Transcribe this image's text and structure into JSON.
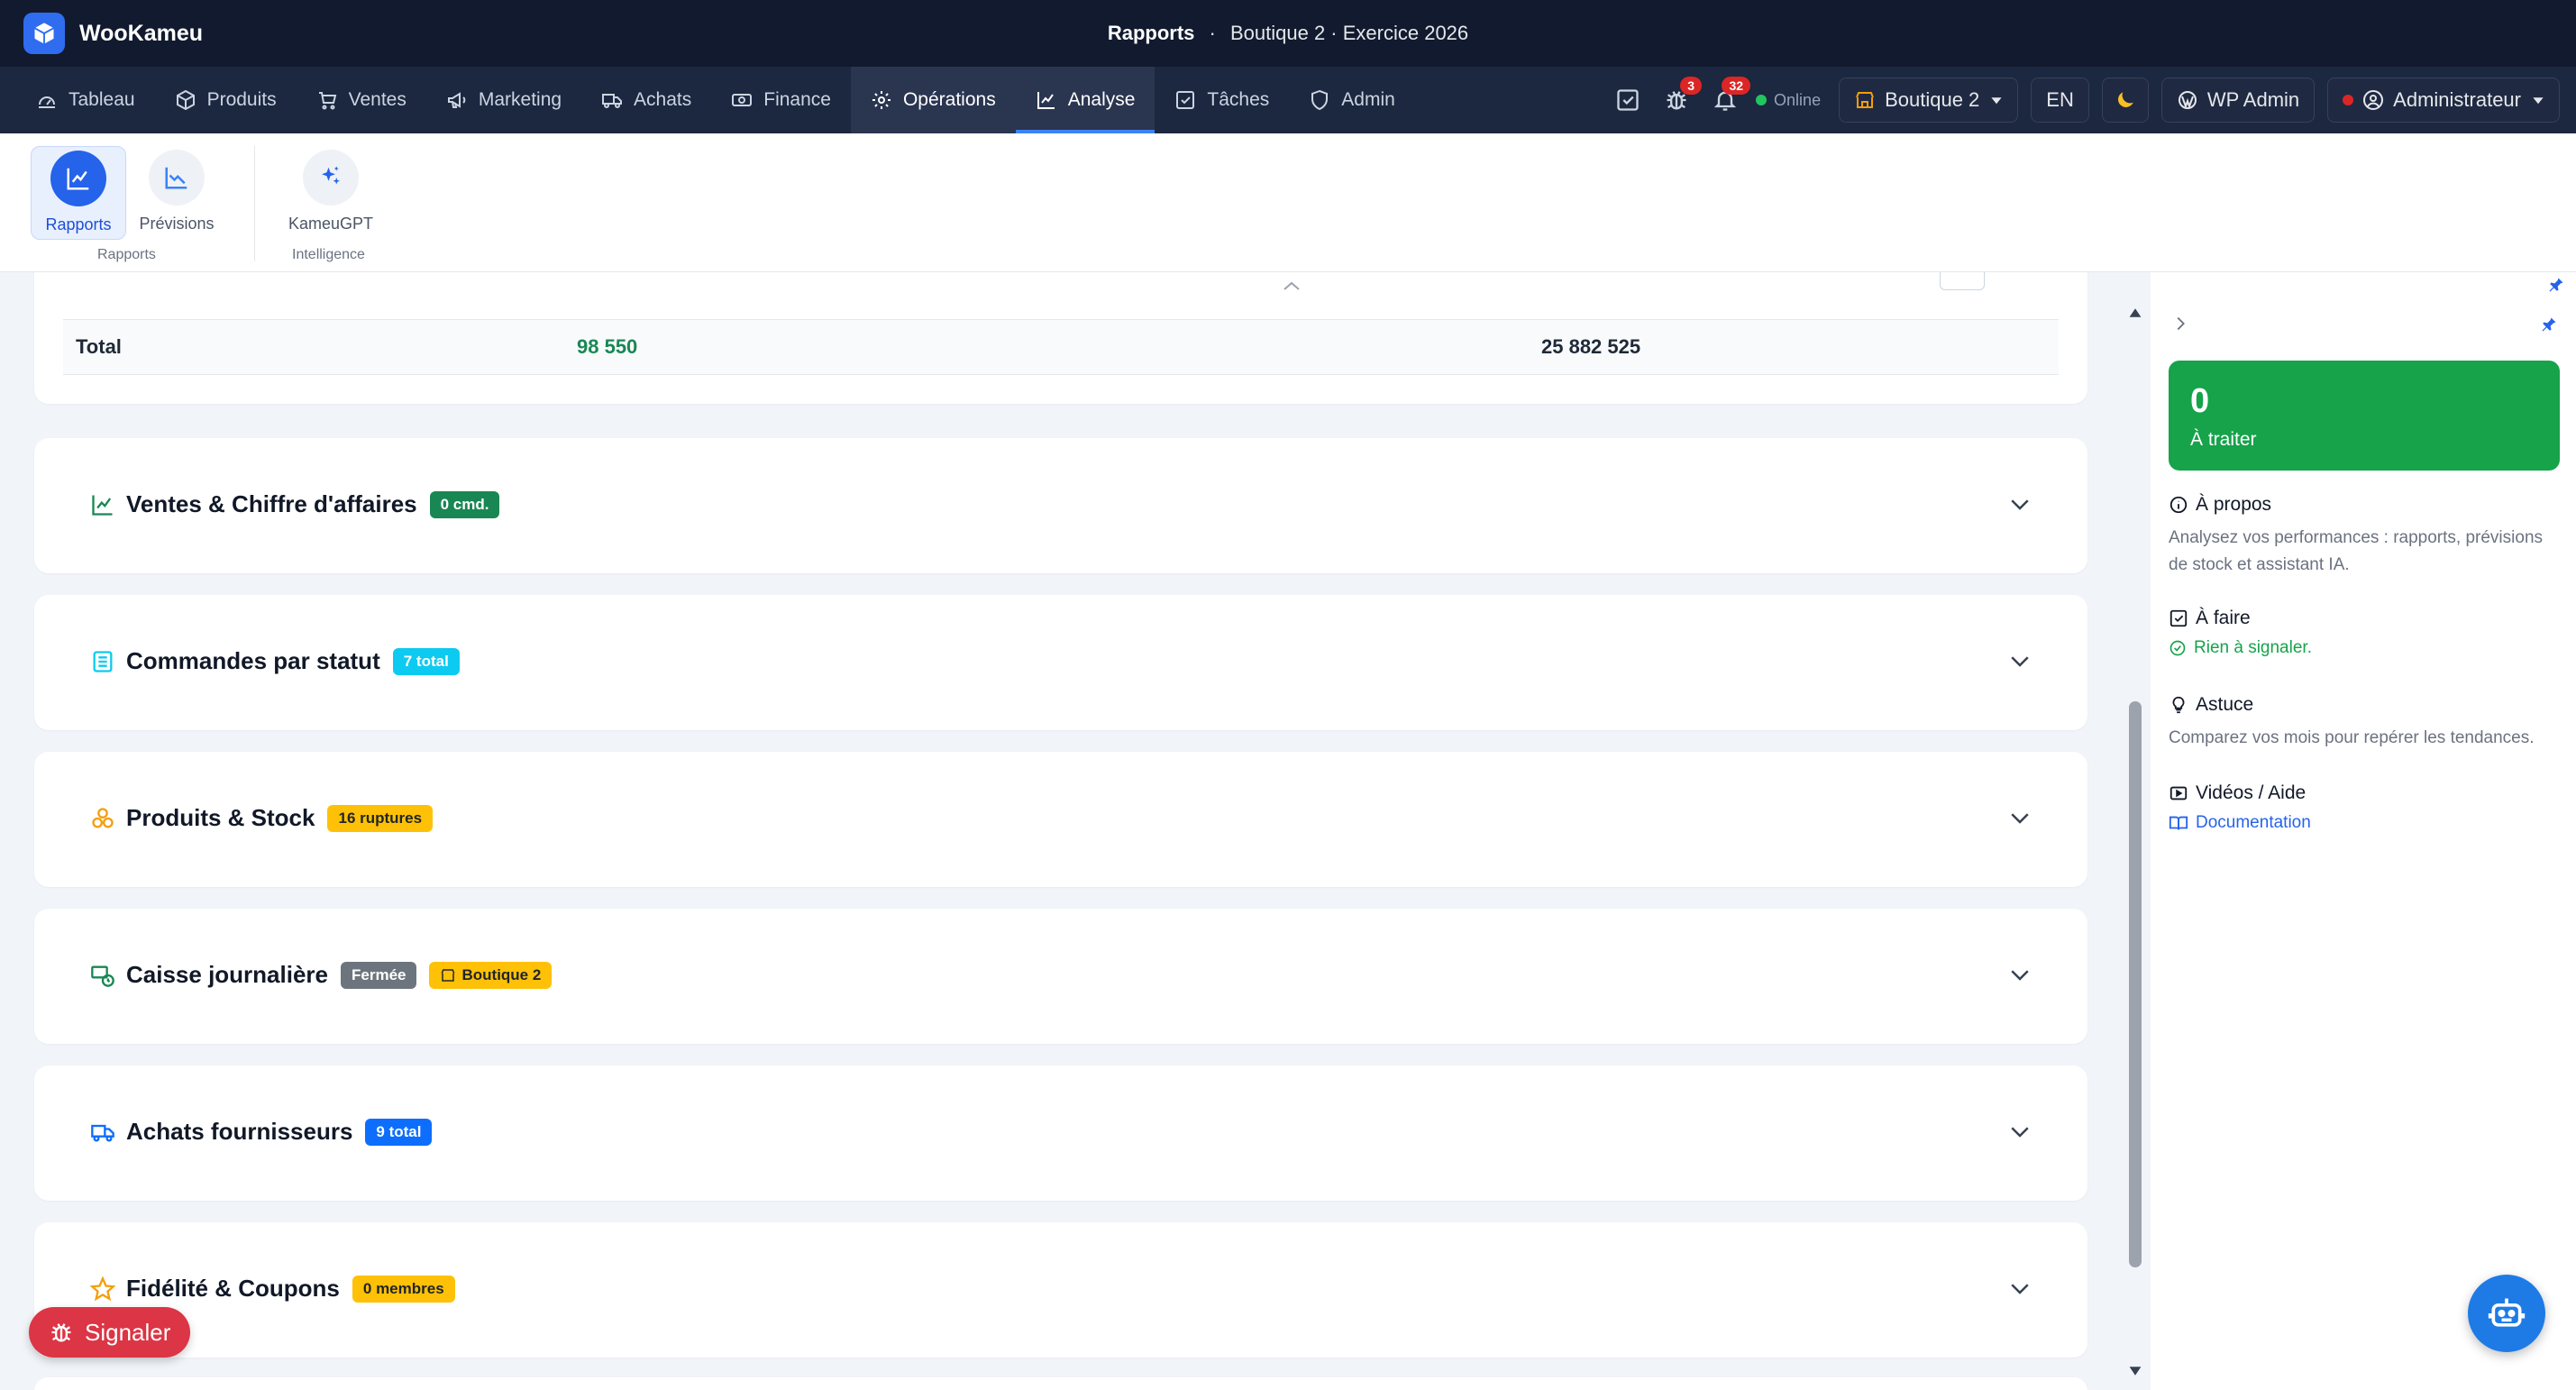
{
  "app": {
    "name": "WooKameu"
  },
  "window": {
    "title_bold": "Rapports",
    "separator": "·",
    "title_rest": "Boutique 2 · Exercice 2026"
  },
  "nav": {
    "items": [
      {
        "label": "Tableau",
        "icon": "gauge-icon"
      },
      {
        "label": "Produits",
        "icon": "box-icon"
      },
      {
        "label": "Ventes",
        "icon": "cart-icon"
      },
      {
        "label": "Marketing",
        "icon": "megaphone-icon"
      },
      {
        "label": "Achats",
        "icon": "truck-icon"
      },
      {
        "label": "Finance",
        "icon": "cash-icon"
      },
      {
        "label": "Opérations",
        "icon": "gear-icon"
      },
      {
        "label": "Analyse",
        "icon": "chart-icon"
      },
      {
        "label": "Tâches",
        "icon": "checkbox-icon"
      },
      {
        "label": "Admin",
        "icon": "shield-icon"
      }
    ],
    "bug_count": "3",
    "notif_count": "32",
    "online": "Online",
    "store": "Boutique 2",
    "lang": "EN",
    "wp_admin": "WP Admin",
    "user": "Administrateur"
  },
  "toolbar": {
    "rapports": "Rapports",
    "previsions": "Prévisions",
    "group_rapports": "Rapports",
    "kameugpt": "KameuGPT",
    "group_intelligence": "Intelligence"
  },
  "totals": {
    "label": "Total",
    "qty": "98 550",
    "amount": "25 882 525"
  },
  "sections": [
    {
      "title": "Ventes & Chiffre d'affaires",
      "tag": "0 cmd.",
      "tag_color": "#198754"
    },
    {
      "title": "Commandes par statut",
      "tag": "7 total",
      "tag_color": "#0dcaf0"
    },
    {
      "title": "Produits & Stock",
      "tag": "16 ruptures",
      "tag_color": "#ffc107"
    },
    {
      "title": "Caisse journalière",
      "tag": "Fermée",
      "tag_color": "#6c757d",
      "tag2": "Boutique 2",
      "tag2_color": "#ffc107"
    },
    {
      "title": "Achats fournisseurs",
      "tag": "9 total",
      "tag_color": "#0d6efd"
    },
    {
      "title": "Fidélité & Coupons",
      "tag": "0 membres",
      "tag_color": "#ffc107"
    }
  ],
  "panel": {
    "count": "0",
    "count_label": "À traiter",
    "about_title": "À propos",
    "about_text": "Analysez vos performances : rapports, prévisions de stock et assistant IA.",
    "todo_title": "À faire",
    "todo_text": "Rien à signaler.",
    "tip_title": "Astuce",
    "tip_text": "Comparez vos mois pour repérer les tendances.",
    "videos_title": "Vidéos / Aide",
    "doc_link": "Documentation"
  },
  "signaler": "Signaler",
  "colors": {
    "nav_bg": "#1c2740",
    "title_bg": "#111a2e",
    "accent": "#2563eb",
    "success": "#16a34a",
    "danger": "#dc3545"
  }
}
